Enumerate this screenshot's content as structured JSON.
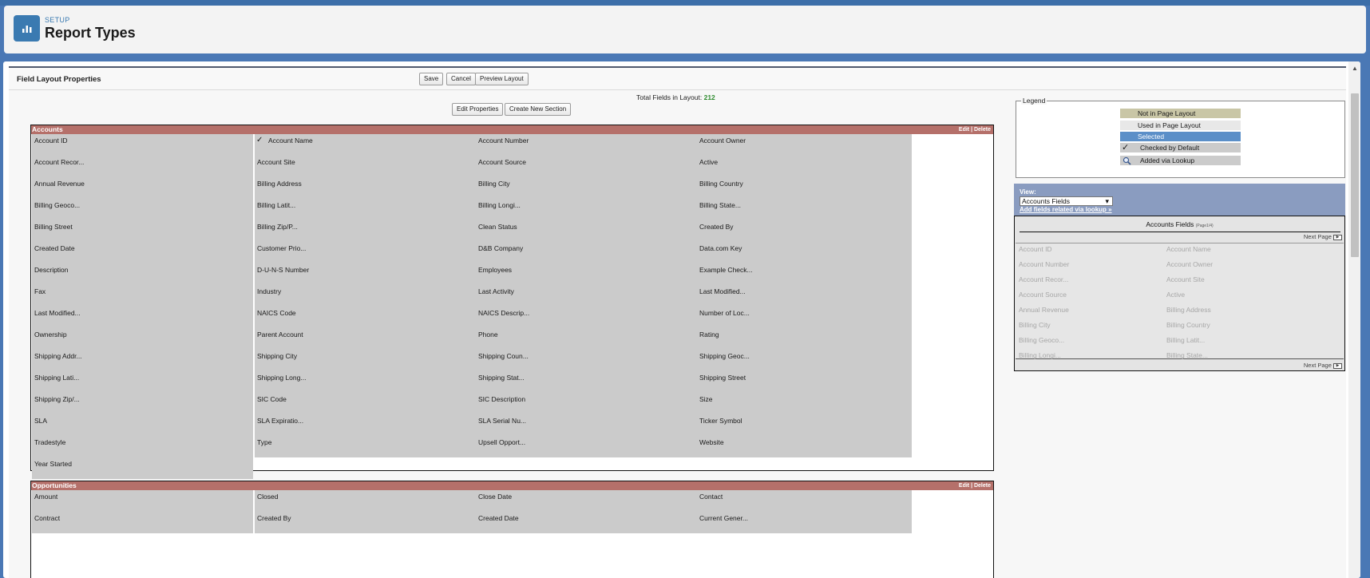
{
  "header": {
    "eyebrow": "SETUP",
    "title": "Report Types",
    "icon": "report-chart-icon"
  },
  "panel": {
    "title": "Field Layout Properties",
    "buttons": {
      "save": "Save",
      "cancel": "Cancel",
      "preview": "Preview Layout",
      "edit_properties": "Edit Properties",
      "create_section": "Create New Section"
    },
    "total_label": "Total Fields in Layout:",
    "total_value": "212"
  },
  "sections": {
    "accounts": {
      "name": "Accounts",
      "actions": "Edit | Delete",
      "columns": [
        [
          "Account ID",
          "Account Recor...",
          "Annual Revenue",
          "Billing Geoco...",
          "Billing Street",
          "Created Date",
          "Description",
          "Fax",
          "Last Modified...",
          "Ownership",
          "Shipping Addr...",
          "Shipping Lati...",
          "Shipping Zip/...",
          "SLA",
          "Tradestyle",
          "Year Started"
        ],
        [
          "Account Name",
          "Account Site",
          "Billing Address",
          "Billing Latit...",
          "Billing Zip/P...",
          "Customer Prio...",
          "D-U-N-S Number",
          "Industry",
          "NAICS Code",
          "Parent Account",
          "Shipping City",
          "Shipping Long...",
          "SIC Code",
          "SLA Expiratio...",
          "Type"
        ],
        [
          "Account Number",
          "Account Source",
          "Billing City",
          "Billing Longi...",
          "Clean Status",
          "D&B Company",
          "Employees",
          "Last Activity",
          "NAICS Descrip...",
          "Phone",
          "Shipping Coun...",
          "Shipping Stat...",
          "SIC Description",
          "SLA Serial Nu...",
          "Upsell Opport..."
        ],
        [
          "Account Owner",
          "Active",
          "Billing Country",
          "Billing State...",
          "Created By",
          "Data.com Key",
          "Example Check...",
          "Last Modified...",
          "Number of Loc...",
          "Rating",
          "Shipping Geoc...",
          "Shipping Street",
          "Size",
          "Ticker Symbol",
          "Website"
        ]
      ],
      "checked_field": "Account Name"
    },
    "opportunities": {
      "name": "Opportunities",
      "actions": "Edit | Delete",
      "columns": [
        [
          "Amount",
          "Contract"
        ],
        [
          "Closed",
          "Created By"
        ],
        [
          "Close Date",
          "Created Date"
        ],
        [
          "Contact",
          "Current Gener..."
        ]
      ]
    }
  },
  "legend": {
    "title": "Legend",
    "items": [
      {
        "label": "Not in Page Layout",
        "color": "#c9c6a6"
      },
      {
        "label": "Used in Page Layout",
        "color": "#e8e8e8"
      },
      {
        "label": "Selected",
        "color": "#5b8fc8"
      },
      {
        "label": "Checked by Default",
        "color": "#cbcbcb",
        "icon": "checkmark-icon"
      },
      {
        "label": "Added via Lookup",
        "color": "#cbcbcb",
        "icon": "magnifier-icon"
      }
    ]
  },
  "view": {
    "label": "View:",
    "selected": "Accounts Fields",
    "lookup_link": "Add fields related via lookup »",
    "fields_title": "Accounts Fields",
    "page_indicator": "(Page1/4)",
    "next_page": "Next Page",
    "available_fields": [
      [
        "Account ID",
        "Account Name"
      ],
      [
        "Account Number",
        "Account Owner"
      ],
      [
        "Account Recor...",
        "Account Site"
      ],
      [
        "Account Source",
        "Active"
      ],
      [
        "Annual Revenue",
        "Billing Address"
      ],
      [
        "Billing City",
        "Billing Country"
      ],
      [
        "Billing Geoco...",
        "Billing Latit..."
      ],
      [
        "Billing Longi...",
        "Billing State..."
      ]
    ]
  }
}
